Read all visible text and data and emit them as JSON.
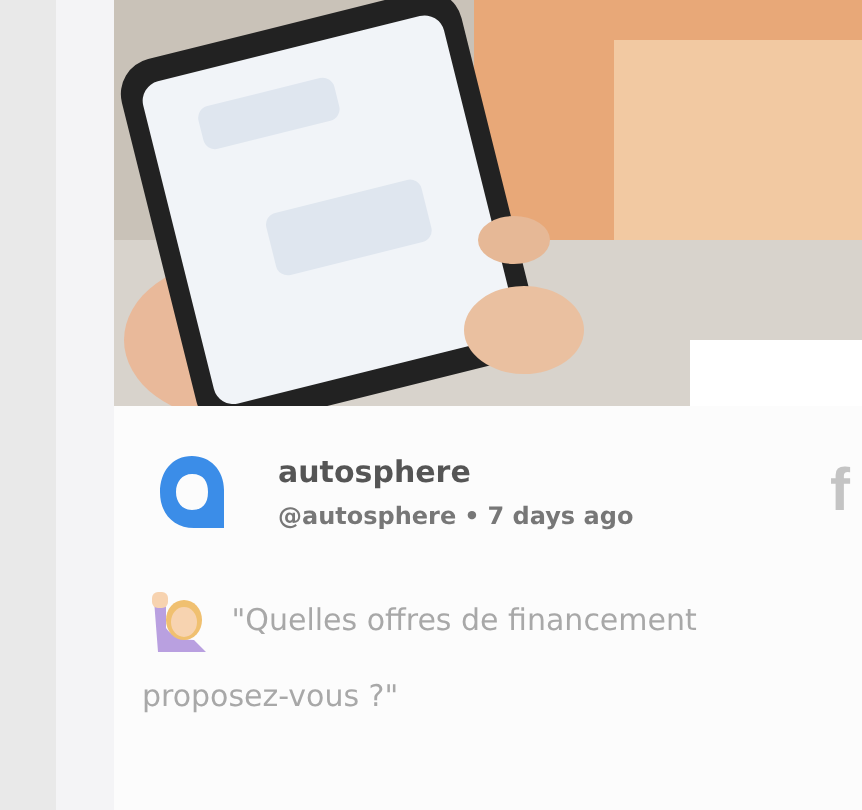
{
  "post": {
    "author": "autosphere",
    "handle": "@autosphere",
    "separator": "•",
    "time": "7 days ago",
    "network_icon": "f",
    "text": "\"Quelles offres de financement proposez-vous ?\""
  }
}
